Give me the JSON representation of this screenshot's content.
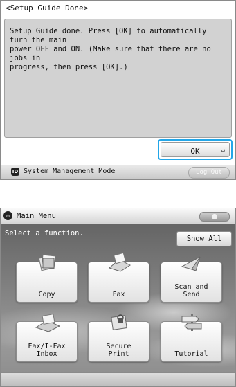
{
  "screen1": {
    "title": "<Setup Guide Done>",
    "message": "Setup Guide done. Press [OK] to automatically turn the main\npower OFF and ON. (Make sure that there are no jobs in\nprogress, then press [OK].)",
    "ok_label": "OK",
    "status": {
      "badge": "ID",
      "mode_text": "System Management Mode",
      "logout_label": "Log Out"
    }
  },
  "screen2": {
    "title": "Main Menu",
    "subtitle": "Select a function.",
    "show_all_label": "Show All",
    "functions": [
      {
        "label": "Copy"
      },
      {
        "label": "Fax"
      },
      {
        "label": "Scan and\nSend"
      },
      {
        "label": "Fax/I-Fax\nInbox"
      },
      {
        "label": "Secure\nPrint"
      },
      {
        "label": "Tutorial"
      }
    ]
  },
  "colors": {
    "focus_border": "#22a6e8",
    "panel_gray": "#d2d2d2"
  },
  "icons": [
    "enter-icon",
    "id-badge-icon",
    "home-icon",
    "copy-icon",
    "fax-icon",
    "scan-send-icon",
    "fax-inbox-icon",
    "secure-print-icon",
    "tutorial-icon"
  ]
}
